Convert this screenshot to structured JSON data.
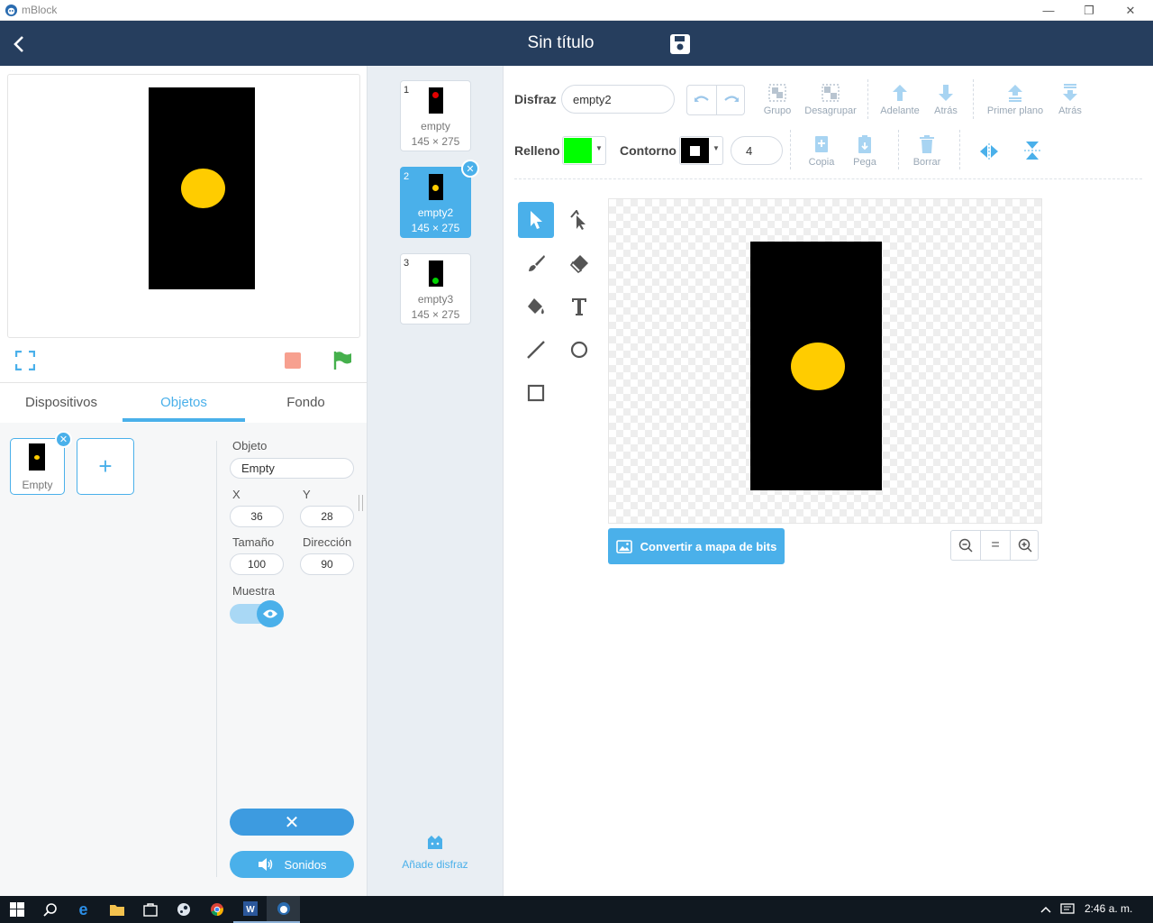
{
  "window": {
    "app_title": "mBlock",
    "minimize": "—",
    "maximize": "❐",
    "close": "✕"
  },
  "header": {
    "title": "Sin título"
  },
  "stage_tabs": [
    {
      "label": "Dispositivos"
    },
    {
      "label": "Objetos"
    },
    {
      "label": "Fondo"
    }
  ],
  "sprite": {
    "name": "Empty",
    "add_label": "+"
  },
  "props": {
    "object_label": "Objeto",
    "object_value": "Empty",
    "x_label": "X",
    "x_value": "36",
    "y_label": "Y",
    "y_value": "28",
    "size_label": "Tamaño",
    "size_value": "100",
    "direction_label": "Dirección",
    "direction_value": "90",
    "show_label": "Muestra",
    "delete_label": "✕",
    "sounds_label": "Sonidos"
  },
  "costumes": [
    {
      "num": "1",
      "name": "empty",
      "size": "145 × 275",
      "dot_color": "#e00000"
    },
    {
      "num": "2",
      "name": "empty2",
      "size": "145 × 275",
      "dot_color": "#ffcc00"
    },
    {
      "num": "3",
      "name": "empty3",
      "size": "145 × 275",
      "dot_color": "#00d400"
    }
  ],
  "add_costume_label": "Añade disfraz",
  "editor": {
    "costume_label": "Disfraz",
    "costume_value": "empty2",
    "group": "Grupo",
    "ungroup": "Desagrupar",
    "forward": "Adelante",
    "backward": "Atrás",
    "front": "Primer plano",
    "back": "Atrás",
    "fill_label": "Relleno",
    "outline_label": "Contorno",
    "outline_width": "4",
    "copy": "Copia",
    "paste": "Pega",
    "delete": "Borrar",
    "convert_label": "Convertir a mapa de bits",
    "zoom_reset": "="
  },
  "colors": {
    "fill": "#00ff00",
    "outline": "#000000",
    "accent": "#4ab0ea",
    "header": "#263e5e",
    "yellow": "#ffcc00"
  },
  "taskbar": {
    "time": "2:46 a. m."
  }
}
